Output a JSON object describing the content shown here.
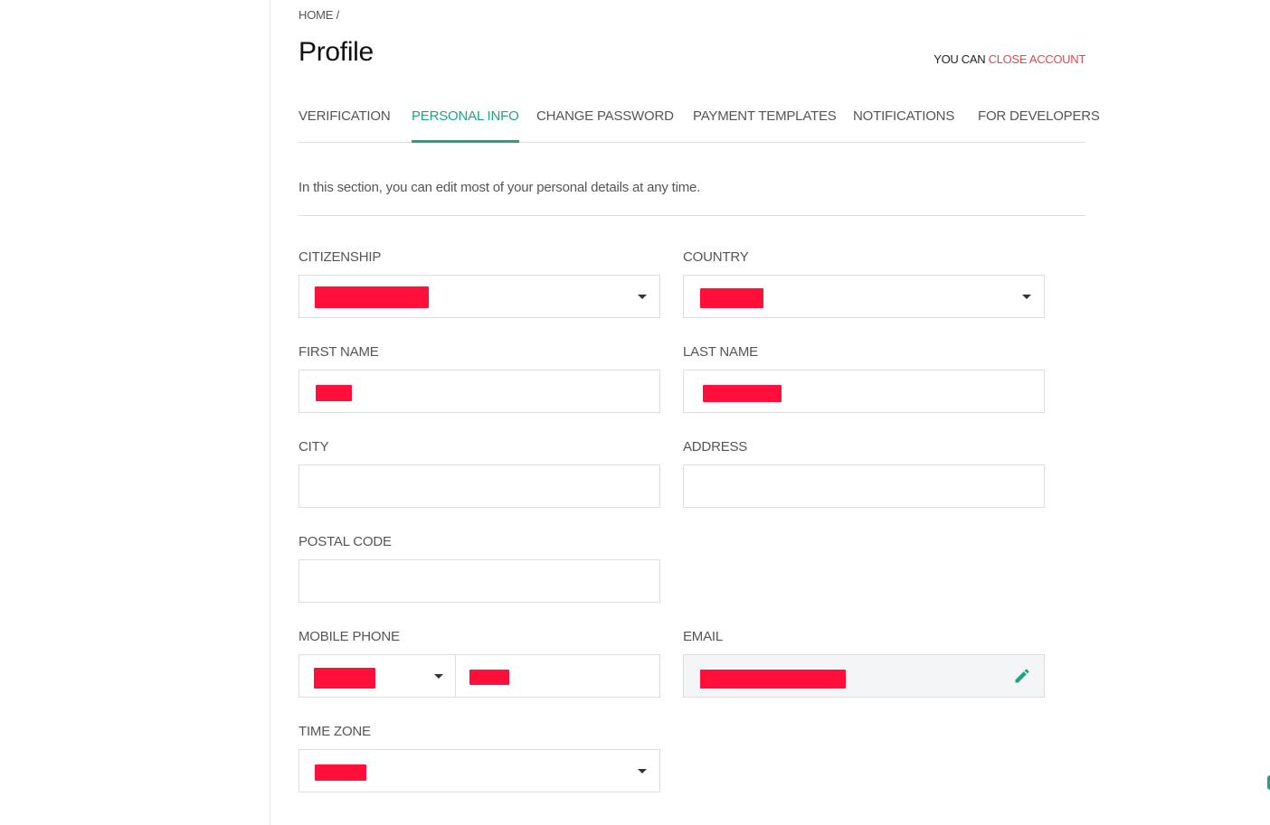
{
  "breadcrumb": "HOME /",
  "page_title": "Profile",
  "account": {
    "prefix": "YOU CAN",
    "link": "CLOSE ACCOUNT"
  },
  "tabs": [
    {
      "label": "VERIFICATION",
      "active": false
    },
    {
      "label": "PERSONAL INFO",
      "active": true
    },
    {
      "label": "CHANGE PASSWORD",
      "active": false
    },
    {
      "label": "PAYMENT TEMPLATES",
      "active": false
    },
    {
      "label": "NOTIFICATIONS",
      "active": false
    },
    {
      "label": "FOR DEVELOPERS",
      "active": false
    }
  ],
  "intro": "In this section, you can edit most of your personal details at any time.",
  "fields": {
    "citizenship": {
      "label": "CITIZENSHIP",
      "value": "[redacted]"
    },
    "country": {
      "label": "COUNTRY",
      "value": "[redacted]"
    },
    "first_name": {
      "label": "FIRST NAME",
      "value": "[redacted]"
    },
    "last_name": {
      "label": "LAST NAME",
      "value": "[redacted]"
    },
    "city": {
      "label": "CITY",
      "value": ""
    },
    "address": {
      "label": "ADDRESS",
      "value": ""
    },
    "postal_code": {
      "label": "POSTAL CODE",
      "value": ""
    },
    "mobile_phone": {
      "label": "MOBILE PHONE",
      "code": "[redacted]",
      "number": "[redacted]"
    },
    "email": {
      "label": "EMAIL",
      "value": "[redacted]"
    },
    "time_zone": {
      "label": "TIME ZONE",
      "value": "[redacted]"
    }
  },
  "colors": {
    "accent": "#1fa481",
    "danger_link": "#e4474f",
    "redaction": "#ff0f3a"
  },
  "icons": {
    "dropdown": "caret-down-icon",
    "edit": "pencil-icon"
  }
}
